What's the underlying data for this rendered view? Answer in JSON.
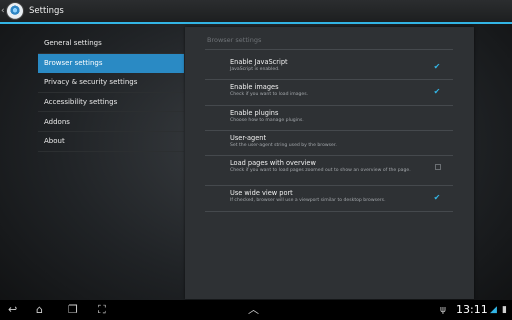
{
  "action_bar": {
    "title": "Settings"
  },
  "headers": [
    {
      "label": "General settings",
      "selected": false
    },
    {
      "label": "Browser settings",
      "selected": true
    },
    {
      "label": "Privacy & security settings",
      "selected": false
    },
    {
      "label": "Accessibility settings",
      "selected": false
    },
    {
      "label": "Addons",
      "selected": false
    },
    {
      "label": "About",
      "selected": false
    }
  ],
  "panel": {
    "title": "Browser settings",
    "prefs": [
      {
        "title": "Enable JavaScript",
        "summary": "JavaScript is enabled.",
        "checkbox": "checked"
      },
      {
        "title": "Enable images",
        "summary": "Check if you want to load images.",
        "checkbox": "checked"
      },
      {
        "title": "Enable plugins",
        "summary": "Choose how to manage plugins.",
        "checkbox": "none"
      },
      {
        "title": "User-agent",
        "summary": "Set the user-agent string used by the browser.",
        "checkbox": "none"
      },
      {
        "title": "Load pages with overview",
        "summary": "Check if you want to load pages zoomed out to show an overview of the page.",
        "checkbox": "unchecked"
      },
      {
        "title": "Use wide view port",
        "summary": "If checked, browser will use a viewport similar to desktop browsers.",
        "checkbox": "checked"
      }
    ]
  },
  "status_bar": {
    "time": "13:11",
    "icons": [
      "back-icon",
      "home-icon",
      "recent-apps-icon",
      "screenshot-icon",
      "menu-up-icon",
      "usb-icon",
      "wifi-icon",
      "battery-icon"
    ]
  },
  "colors": {
    "accent": "#33b5e5",
    "selected": "#2a8ac4",
    "panel": "#2e3134"
  }
}
